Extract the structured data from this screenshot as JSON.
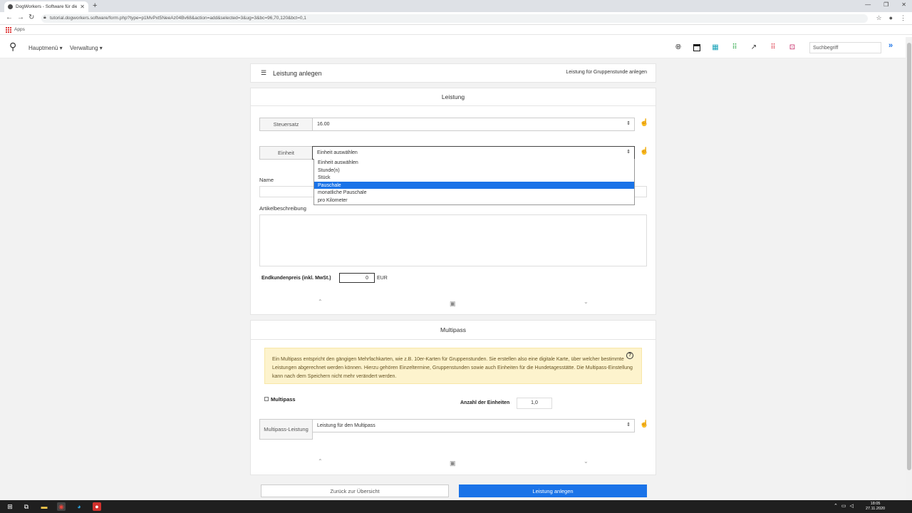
{
  "browser": {
    "tab_title": "DogWorkers - Software für die H",
    "url": "tutorial.dogworkers.software/form.php?type=p1MvPxt5NeeAz04Bv68&action=add&selected=3&ug=3&bc=96,70,120&bct=0,1",
    "bookmarks_label": "Apps"
  },
  "header": {
    "menu_main": "Hauptmenü ▾",
    "menu_admin": "Verwaltung ▾",
    "search_placeholder": "Suchbegriff",
    "icon_colors": {
      "teal": "#17a2b8",
      "green": "#28a745",
      "red": "#dc3545",
      "magenta": "#c2185b"
    }
  },
  "form_header": {
    "title": "Leistung anlegen",
    "right_link": "Leistung für Gruppenstunde anlegen"
  },
  "leistung": {
    "section_title": "Leistung",
    "steuersatz_label": "Steuersatz",
    "steuersatz_value": "16.00",
    "einheit_label": "Einheit",
    "einheit_value": "Einheit auswählen",
    "einheit_options": [
      "Einheit auswählen",
      "Stunde(n)",
      "Stück",
      "Pauschale",
      "monatliche Pauschale",
      "pro Kilometer"
    ],
    "einheit_highlighted": "Pauschale",
    "name_label": "Name",
    "artikel_label": "Artikelbeschreibung",
    "price_label": "Endkundenpreis (inkl. MwSt.)",
    "price_value": "0",
    "currency": "EUR"
  },
  "multipass": {
    "section_title": "Multipass",
    "info_text": "Ein Multipass entspricht den gängigen Mehrfachkarten, wie z.B. 10er-Karten für Gruppenstunden. Sie erstellen also eine digitale Karte, über welcher bestimmte Leistungen abgerechnet werden können. Hierzu gehören Einzeltermine, Gruppenstunden sowie auch Einheiten für die Hundetagesstätte. Die Multipass-Einstellung kann nach dem Speichern nicht mehr verändert werden.",
    "checkbox_label": "Multipass",
    "anzahl_label": "Anzahl der Einheiten",
    "anzahl_value": "1,0",
    "leistung_label": "Multipass-Leistung",
    "leistung_value": "Leistung für den Multipass"
  },
  "buttons": {
    "back": "Zurück zur Übersicht",
    "save": "Leistung anlegen"
  },
  "taskbar": {
    "time": "18:05",
    "date": "27.11.2020"
  }
}
